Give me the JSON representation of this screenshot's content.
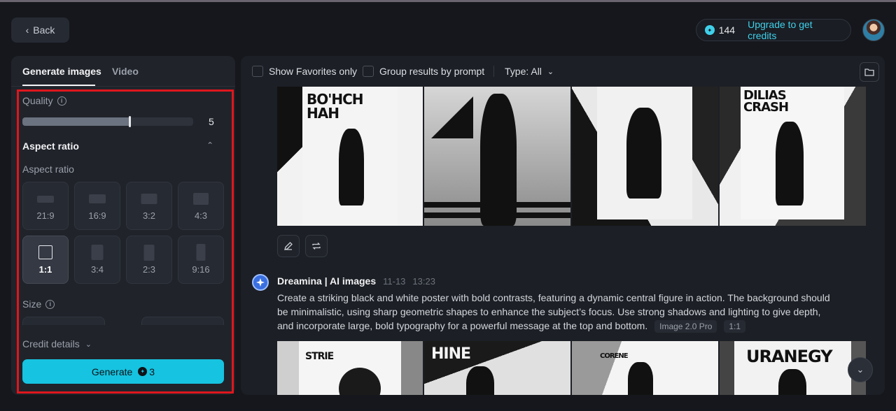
{
  "header": {
    "back_label": "Back",
    "credits_count": "144",
    "upgrade_label": "Upgrade to get credits"
  },
  "left_panel": {
    "tabs": [
      {
        "label": "Generate images",
        "active": true
      },
      {
        "label": "Video",
        "active": false
      }
    ],
    "quality": {
      "label": "Quality",
      "value": 5,
      "min": 0,
      "max": 8
    },
    "aspect_ratio": {
      "section_title": "Aspect ratio",
      "label": "Aspect ratio",
      "options": [
        {
          "label": "21:9",
          "selected": false
        },
        {
          "label": "16:9",
          "selected": false
        },
        {
          "label": "3:2",
          "selected": false
        },
        {
          "label": "4:3",
          "selected": false
        },
        {
          "label": "1:1",
          "selected": true
        },
        {
          "label": "3:4",
          "selected": false
        },
        {
          "label": "2:3",
          "selected": false
        },
        {
          "label": "9:16",
          "selected": false
        }
      ]
    },
    "size": {
      "label": "Size"
    },
    "credit_details_label": "Credit details",
    "generate": {
      "label": "Generate",
      "cost": "3"
    }
  },
  "main_panel": {
    "toolbar": {
      "favorites_label": "Show Favorites only",
      "group_label": "Group results by prompt",
      "type_label": "Type: All"
    },
    "prompt": {
      "source": "Dreamina | AI images",
      "date": "11-13",
      "time": "13:23",
      "text": "Create a striking black and white poster with bold contrasts, featuring a dynamic central figure in action. The background should be minimalistic, using sharp geometric shapes to enhance the subject’s focus. Use strong shadows and lighting to give depth, and incorporate large, bold typography for a powerful message at the top and bottom.",
      "model_tag": "Image 2.0 Pro",
      "ratio_tag": "1:1"
    },
    "poster_texts": {
      "p1": "BO'HCH HAH",
      "p4": "DILIAS CRASH",
      "d1": "STRIE",
      "d2": "HINE",
      "d3": "CORENE",
      "d4": "URANEGY"
    }
  },
  "colors": {
    "accent": "#16c3e0",
    "link": "#3fd0ea",
    "highlight_box": "#e0161d"
  }
}
